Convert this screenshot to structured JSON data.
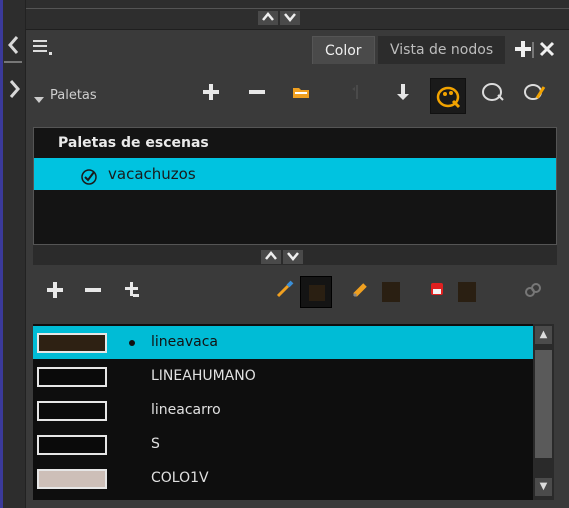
{
  "top_splitter": {
    "up_icon": "chevron-up-icon",
    "down_icon": "chevron-down-icon"
  },
  "left_strip": {
    "collapse_icon": "chevron-left-icon",
    "expand_icon": "chevron-right-icon"
  },
  "header": {
    "menu_icon": "menu-icon",
    "tabs": [
      {
        "label": "Color",
        "active": true
      },
      {
        "label": "Vista de nodos",
        "active": false
      }
    ],
    "add_tab_icon": "plus-icon",
    "close_icon": "close-icon"
  },
  "palettes_toolbar": {
    "title": "Paletas",
    "buttons": [
      "plus-icon",
      "minus-icon",
      "folder-icon",
      "hand-icon",
      "arrow-down-icon",
      "palette-icon",
      "palette-outline-icon",
      "palette-edit-icon"
    ]
  },
  "scene_palettes": {
    "header": "Paletas de escenas",
    "items": [
      {
        "label": "vacachuzos",
        "selected": true,
        "checked": true
      }
    ]
  },
  "middle_splitter": {
    "up_icon": "chevron-up-icon",
    "down_icon": "chevron-down-icon"
  },
  "colors_toolbar": {
    "buttons": [
      "plus-icon",
      "minus-icon",
      "clone-icon",
      "brush-icon",
      "pencil-icon",
      "paint-icon",
      "link-icon"
    ],
    "swatch_colors": [
      "#2a1f12",
      "#2a1f12",
      "#2a1f12"
    ]
  },
  "color_list": {
    "items": [
      {
        "name": "lineavaca",
        "color": "#2e2113",
        "selected": true
      },
      {
        "name": "LINEAHUMANO",
        "color": "#0a0a0a",
        "selected": false
      },
      {
        "name": "lineacarro",
        "color": "#0a0a0a",
        "selected": false
      },
      {
        "name": "S",
        "color": "#0a0a0a",
        "selected": false
      },
      {
        "name": "COLO1V",
        "color": "#cdbfb8",
        "selected": false
      }
    ]
  },
  "accent_color": "#00bcd6"
}
